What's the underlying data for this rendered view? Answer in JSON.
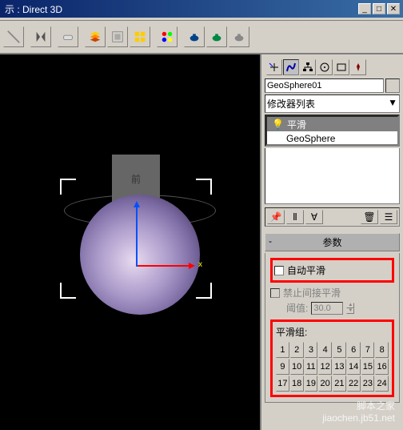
{
  "window": {
    "title": "示 : Direct 3D"
  },
  "viewport": {
    "cube_label": "前",
    "axis_x": "x"
  },
  "panel": {
    "object_name": "GeoSphere01",
    "modifier_list_label": "修改器列表",
    "modifiers": [
      {
        "label": "平滑",
        "icon": "💡"
      },
      {
        "label": "GeoSphere"
      }
    ],
    "rollout_title": "参数",
    "rollout_minus": "-",
    "auto_smooth": "自动平滑",
    "prevent_indirect": "禁止间接平滑",
    "threshold_label": "阈值:",
    "threshold_value": "30.0",
    "smooth_group_label": "平滑组:",
    "smooth_groups": [
      "1",
      "2",
      "3",
      "4",
      "5",
      "6",
      "7",
      "8",
      "9",
      "10",
      "11",
      "12",
      "13",
      "14",
      "15",
      "16",
      "17",
      "18",
      "19",
      "20",
      "21",
      "22",
      "23",
      "24"
    ]
  },
  "watermark": {
    "line1": "脚本之家",
    "line2": "jiaochen.jb51.net"
  }
}
